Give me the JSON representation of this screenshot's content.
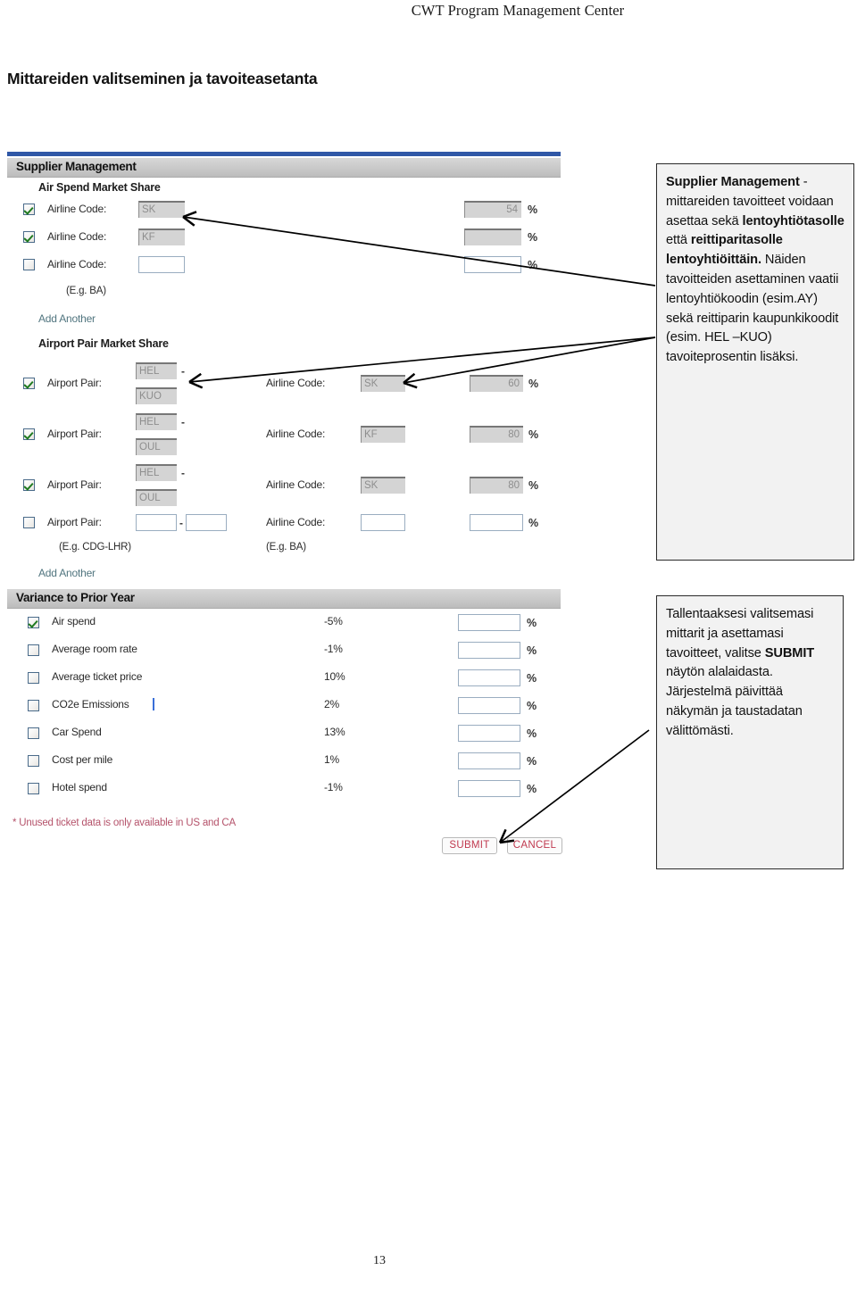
{
  "document": {
    "running_head": "CWT Program Management Center",
    "title": "Mittareiden valitseminen ja tavoiteasetanta",
    "page_number": "13"
  },
  "screenshot": {
    "supplier_management": {
      "section_title": "Supplier Management",
      "air_spend": {
        "subhead": "Air Spend Market Share",
        "hint": "(E.g. BA)",
        "add_another": "Add Another",
        "percent_sign": "%",
        "rows": [
          {
            "checked": true,
            "label": "Airline Code:",
            "code": "SK",
            "percent": "54",
            "readonly": true
          },
          {
            "checked": true,
            "label": "Airline Code:",
            "code": "KF",
            "percent": "",
            "readonly": true
          },
          {
            "checked": false,
            "label": "Airline Code:",
            "code": "",
            "percent": "",
            "readonly": false
          }
        ]
      },
      "airport_pair": {
        "subhead": "Airport Pair Market Share",
        "hint_pair": "(E.g. CDG-LHR)",
        "hint_airline": "(E.g. BA)",
        "add_another": "Add Another",
        "separator": "-",
        "percent_sign": "%",
        "airline_label": "Airline Code:",
        "rows": [
          {
            "checked": true,
            "label": "Airport Pair:",
            "origin": "HEL",
            "destination": "KUO",
            "airline": "SK",
            "percent": "60",
            "readonly": true
          },
          {
            "checked": true,
            "label": "Airport Pair:",
            "origin": "HEL",
            "destination": "OUL",
            "airline": "KF",
            "percent": "80",
            "readonly": true
          },
          {
            "checked": true,
            "label": "Airport Pair:",
            "origin": "HEL",
            "destination": "OUL",
            "airline": "SK",
            "percent": "80",
            "readonly": true
          },
          {
            "checked": false,
            "label": "Airport Pair:",
            "origin": "",
            "destination": "",
            "airline": "",
            "percent": "",
            "readonly": false
          }
        ]
      }
    },
    "variance": {
      "section_title": "Variance to Prior Year",
      "percent_sign": "%",
      "rows": [
        {
          "checked": true,
          "label": "Air spend",
          "value": "-5%",
          "target": ""
        },
        {
          "checked": false,
          "label": "Average room rate",
          "value": "-1%",
          "target": ""
        },
        {
          "checked": false,
          "label": "Average ticket price",
          "value": "10%",
          "target": ""
        },
        {
          "checked": false,
          "label": "CO2e Emissions",
          "value": "2%",
          "target": "",
          "caret": true
        },
        {
          "checked": false,
          "label": "Car Spend",
          "value": "13%",
          "target": ""
        },
        {
          "checked": false,
          "label": "Cost per mile",
          "value": "1%",
          "target": ""
        },
        {
          "checked": false,
          "label": "Hotel spend",
          "value": "-1%",
          "target": ""
        }
      ],
      "footnote": "* Unused ticket data is only available in US and CA",
      "submit_label": "SUBMIT",
      "cancel_label": "CANCEL"
    }
  },
  "callouts": {
    "one": {
      "p1_bold": "Supplier Management",
      "p1_a": " - mittareiden tavoitteet voidaan asettaa sekä ",
      "p1_bold2": "lentoyhtiötasolle",
      "p1_b": " että ",
      "p1_bold3": "reittiparitasolle lentoyhtiöittäin.",
      "p1_c": " Näiden tavoitteiden asettaminen vaatii lentoyhtiökoodin (esim.AY) sekä reittiparin kaupunkikoodit (esim. HEL –KUO) tavoiteprosentin lisäksi."
    },
    "two": {
      "p1_a": "Tallentaaksesi valitsemasi mittarit ja asettamasi tavoitteet, valitse ",
      "p1_bold": "SUBMIT",
      "p1_b": " näytön alalaidasta. Järjestelmä päivittää näkymän ja taustadatan välittömästi."
    }
  },
  "colors": {
    "accent_blue": "#2f57a6",
    "check_green": "#1f7a1f",
    "button_red": "#c0394f",
    "footnote_red": "#b5536b",
    "link_teal": "#51757f"
  }
}
